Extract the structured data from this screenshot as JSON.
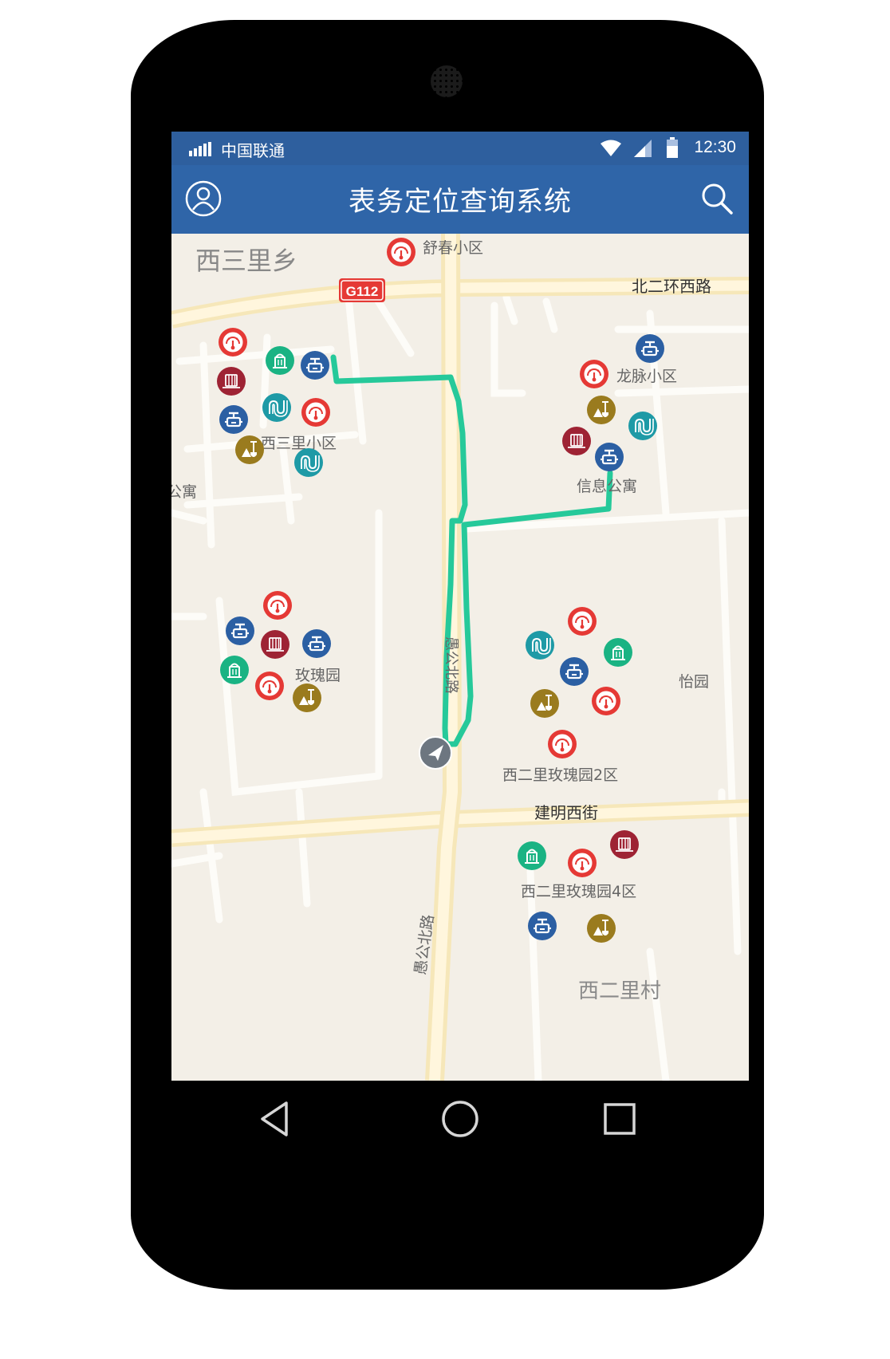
{
  "status": {
    "carrier": "中国联通",
    "time": "12:30"
  },
  "app": {
    "title": "表务定位查询系统",
    "profile_icon": "user-circle-icon",
    "search_icon": "search-icon"
  },
  "map": {
    "labels": {
      "xisanlixiang": "西三里乡",
      "shuchun": "舒春小区",
      "g112": "G112",
      "beierhuan": "北二环西路",
      "longmai": "龙脉小区",
      "xisanli_xiaoqu": "西三里小区",
      "gongyu": "公寓",
      "xinxi_gongyu": "信息公寓",
      "meiguiyuan": "玫瑰园",
      "yugong_bei_1": "愚公北路",
      "yi": "怡园",
      "meiguiyuan2": "西二里玫瑰园2区",
      "jianming": "建明西街",
      "meiguiyuan4": "西二里玫瑰园4区",
      "yugong_bei_2": "愚公北路",
      "xierlicun": "西二里村"
    },
    "route_color": "#26c99a",
    "location_icon": "navigation-arrow-icon"
  },
  "marker_types": {
    "meter": {
      "color": "#e53935",
      "icon": "gauge-meter-icon"
    },
    "valve": {
      "color": "#2b5fa3",
      "icon": "pipe-valve-icon"
    },
    "hydrant": {
      "color": "#1ab383",
      "icon": "fire-hydrant-icon"
    },
    "heater": {
      "color": "#9e2334",
      "icon": "radiator-icon"
    },
    "pipe": {
      "color": "#1e9aa6",
      "icon": "pipe-coil-icon"
    },
    "repair": {
      "color": "#9a7b1e",
      "icon": "shovel-repair-icon"
    }
  },
  "nav": {
    "back_icon": "back-triangle-icon",
    "home_icon": "home-circle-icon",
    "recent_icon": "recent-square-icon"
  }
}
